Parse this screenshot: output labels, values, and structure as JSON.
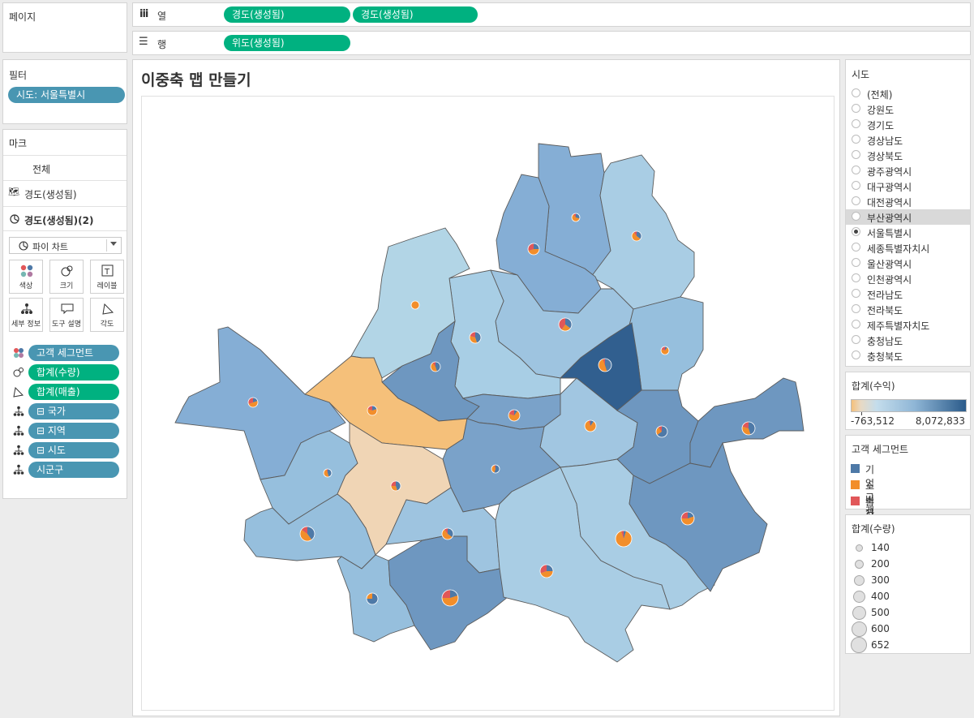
{
  "pages": {
    "title": "페이지"
  },
  "columns_shelf": {
    "label": "열",
    "pills": [
      "경도(생성됨)",
      "경도(생성됨)"
    ]
  },
  "rows_shelf": {
    "label": "행",
    "pills": [
      "위도(생성됨)"
    ]
  },
  "filters": {
    "title": "필터",
    "items": [
      "시도: 서울특별시"
    ]
  },
  "marks": {
    "title": "마크",
    "all": "전체",
    "layer1": "경도(생성됨)",
    "layer2": "경도(생성됨)(2)",
    "mark_type": "파이 차트",
    "buttons": [
      "색상",
      "크기",
      "레이블",
      "세부 정보",
      "도구 설명",
      "각도"
    ],
    "encodings": [
      {
        "icon": "color-icon",
        "label": "고객 세그먼트",
        "color": "#4996b2"
      },
      {
        "icon": "size-icon",
        "label": "합계(수량)",
        "color": "#00b180"
      },
      {
        "icon": "angle-icon",
        "label": "합계(매출)",
        "color": "#00b180"
      },
      {
        "icon": "detail-icon",
        "label": "⊟ 국가",
        "color": "#4996b2"
      },
      {
        "icon": "detail-icon",
        "label": "⊟ 지역",
        "color": "#4996b2"
      },
      {
        "icon": "detail-icon",
        "label": "⊟ 시도",
        "color": "#4996b2"
      },
      {
        "icon": "detail-icon",
        "label": "시군구",
        "color": "#4996b2"
      }
    ]
  },
  "view": {
    "title": "이중축 맵 만들기"
  },
  "sido_filter": {
    "title": "시도",
    "options": [
      "(전체)",
      "강원도",
      "경기도",
      "경상남도",
      "경상북도",
      "광주광역시",
      "대구광역시",
      "대전광역시",
      "부산광역시",
      "서울특별시",
      "세종특별자치시",
      "울산광역시",
      "인천광역시",
      "전라남도",
      "전라북도",
      "제주특별자치도",
      "충청남도",
      "충청북도"
    ],
    "selected": "서울특별시",
    "highlighted": "부산광역시"
  },
  "profit_legend": {
    "title": "합계(수익)",
    "min": "-763,512",
    "max": "8,072,833",
    "colors": [
      "#f5c07a",
      "#b4d4e8",
      "#2b5b8a"
    ]
  },
  "segment_legend": {
    "title": "고객 세그먼트",
    "items": [
      {
        "label": "기업 고객",
        "color": "#4e79a7"
      },
      {
        "label": "소비자",
        "color": "#f28e2b"
      },
      {
        "label": "홈 오피스",
        "color": "#e15759"
      }
    ]
  },
  "quantity_legend": {
    "title": "합계(수량)",
    "items": [
      "140",
      "200",
      "300",
      "400",
      "500",
      "600",
      "652"
    ]
  }
}
